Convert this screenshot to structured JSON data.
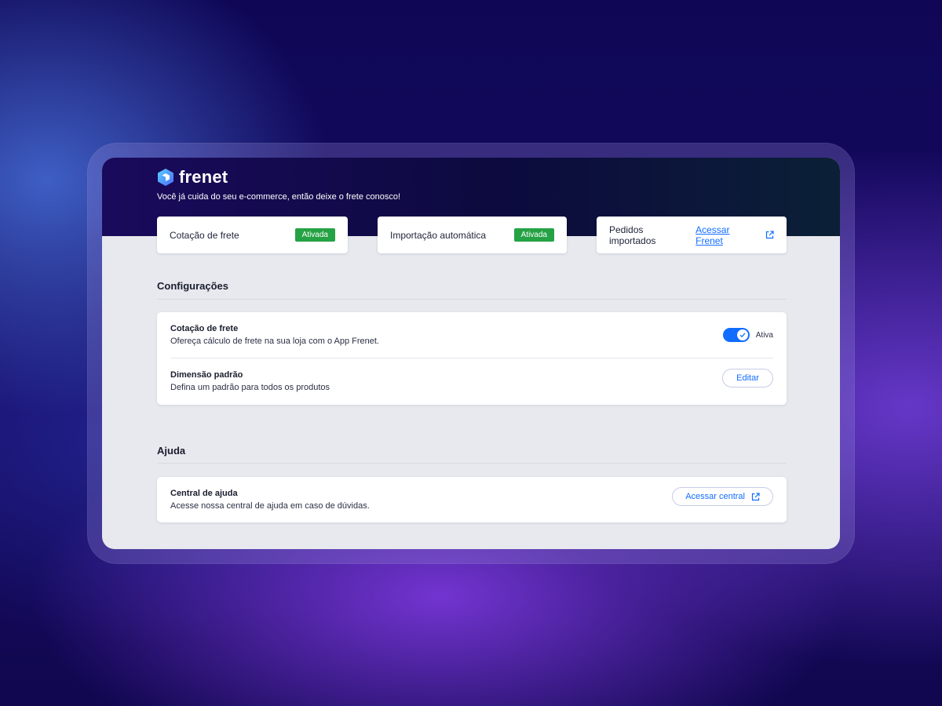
{
  "colors": {
    "accent": "#116dff",
    "badge_active": "#25a244",
    "hero_dark": "#0c0a3e"
  },
  "header": {
    "logo_text": "frenet",
    "logo_icon": "hexagon-logo-icon",
    "tagline": "Você já cuida do seu e-commerce, então deixe o frete conosco!"
  },
  "status_cards": [
    {
      "label": "Cotação de frete",
      "badge": "Ativada"
    },
    {
      "label": "Importação automática",
      "badge": "Ativada"
    },
    {
      "label": "Pedidos importados",
      "link": "Acessar Frenet",
      "icon": "external-link-icon"
    }
  ],
  "settings": {
    "title": "Configurações",
    "rows": [
      {
        "title": "Cotação de frete",
        "description": "Ofereça cálculo de frete na sua loja com o App Frenet.",
        "toggle_on": true,
        "toggle_label": "Ativa"
      },
      {
        "title": "Dimensão padrão",
        "description": "Defina um padrão para todos os produtos",
        "button": "Editar"
      }
    ]
  },
  "help": {
    "title": "Ajuda",
    "rows": [
      {
        "title": "Central de ajuda",
        "description": "Acesse nossa central de ajuda em caso de dúvidas.",
        "button": "Acessar central",
        "icon": "external-link-icon"
      }
    ]
  }
}
